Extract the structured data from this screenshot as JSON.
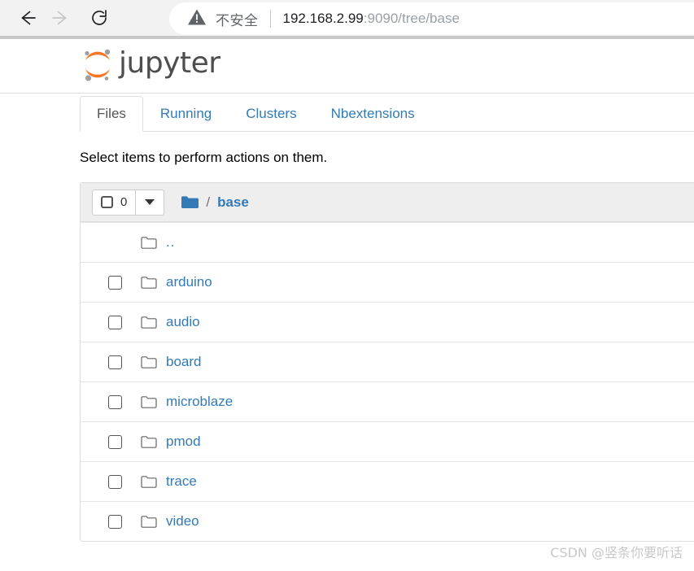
{
  "browser": {
    "back_icon": "back-arrow-icon",
    "forward_icon": "forward-arrow-icon",
    "reload_icon": "reload-icon",
    "security_icon": "warning-triangle-icon",
    "security_label": "不安全",
    "url_host": "192.168.2.99",
    "url_rest": ":9090/tree/base",
    "url_full": "192.168.2.99:9090/tree/base"
  },
  "header": {
    "logo_icon": "jupyter-logo-icon",
    "brand": "jupyter",
    "brand_color": "#4e4e4e",
    "logo_color": "#f37726"
  },
  "tabs": [
    {
      "label": "Files",
      "active": true
    },
    {
      "label": "Running",
      "active": false
    },
    {
      "label": "Clusters",
      "active": false
    },
    {
      "label": "Nbextensions",
      "active": false
    }
  ],
  "notice": "Select items to perform actions on them.",
  "toolbar": {
    "select_all_checkbox": "select-all-checkbox",
    "selected_count": "0",
    "dropdown_icon": "caret-down-icon",
    "breadcrumb_folder_icon": "folder-filled-icon",
    "breadcrumb_separator": "/",
    "breadcrumb_path": "base"
  },
  "files": [
    {
      "name": "..",
      "icon": "folder-outline-icon",
      "has_checkbox": false
    },
    {
      "name": "arduino",
      "icon": "folder-outline-icon",
      "has_checkbox": true
    },
    {
      "name": "audio",
      "icon": "folder-outline-icon",
      "has_checkbox": true
    },
    {
      "name": "board",
      "icon": "folder-outline-icon",
      "has_checkbox": true
    },
    {
      "name": "microblaze",
      "icon": "folder-outline-icon",
      "has_checkbox": true
    },
    {
      "name": "pmod",
      "icon": "folder-outline-icon",
      "has_checkbox": true
    },
    {
      "name": "trace",
      "icon": "folder-outline-icon",
      "has_checkbox": true
    },
    {
      "name": "video",
      "icon": "folder-outline-icon",
      "has_checkbox": true
    }
  ],
  "colors": {
    "link": "#337ab7",
    "toolbar_bg": "#eeeeee",
    "border": "#dddddd"
  },
  "watermark": "CSDN @竖条你要听话"
}
